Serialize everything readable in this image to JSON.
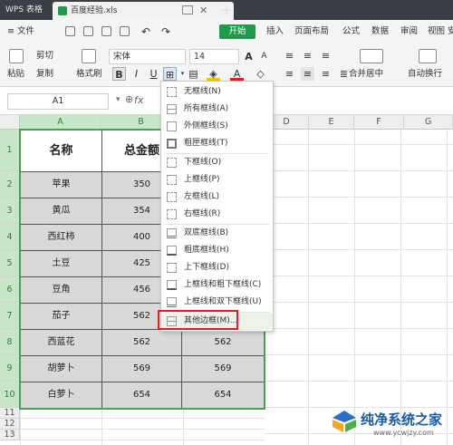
{
  "tabbar": {
    "app_tab": "WPS 表格",
    "doc_name": "百度经验.xls",
    "new_tab": "+"
  },
  "menu_row": {
    "file": "≡ 文件",
    "start": "开始",
    "items": [
      "插入",
      "页面布局",
      "公式",
      "数据",
      "审阅",
      "视图",
      "安"
    ]
  },
  "ribbon": {
    "paste": "粘贴",
    "cut": "剪切",
    "copy": "复制",
    "format_painter": "格式刷",
    "font_name": "宋体",
    "font_size": "14",
    "bold": "B",
    "italic": "I",
    "underline": "U",
    "merge_center": "合并居中",
    "auto_wrap": "自动换行"
  },
  "formula_bar": {
    "cell_ref": "A1",
    "fx": "fx"
  },
  "grid": {
    "columns": [
      "A",
      "B",
      "C",
      "D",
      "E",
      "F",
      "G"
    ],
    "rows": [
      "1",
      "2",
      "3",
      "4",
      "5",
      "6",
      "7",
      "8",
      "9",
      "10",
      "11",
      "12",
      "13"
    ],
    "header": [
      "名称",
      "总金额"
    ],
    "data": [
      [
        "苹果",
        "350",
        ""
      ],
      [
        "黄瓜",
        "354",
        ""
      ],
      [
        "西红柿",
        "400",
        ""
      ],
      [
        "土豆",
        "425",
        ""
      ],
      [
        "豆角",
        "456",
        ""
      ],
      [
        "茄子",
        "562",
        ""
      ],
      [
        "西蓝花",
        "562",
        "562"
      ],
      [
        "胡萝卜",
        "569",
        "569"
      ],
      [
        "白萝卜",
        "654",
        "654"
      ]
    ]
  },
  "border_menu": {
    "items": [
      "无框线(N)",
      "所有框线(A)",
      "外侧框线(S)",
      "粗匣框线(T)",
      "下框线(O)",
      "上框线(P)",
      "左框线(L)",
      "右框线(R)",
      "双底框线(B)",
      "粗底框线(H)",
      "上下框线(D)",
      "上框线和粗下框线(C)",
      "上框线和双下框线(U)",
      "其他边框(M)..."
    ]
  },
  "watermark": {
    "text": "纯净系统之家",
    "url": "www.ycwjzy.com"
  },
  "colors": {
    "accent_green": "#1e9a4a",
    "highlight_red": "#e02020",
    "table_fill": "#d9d9d9"
  }
}
